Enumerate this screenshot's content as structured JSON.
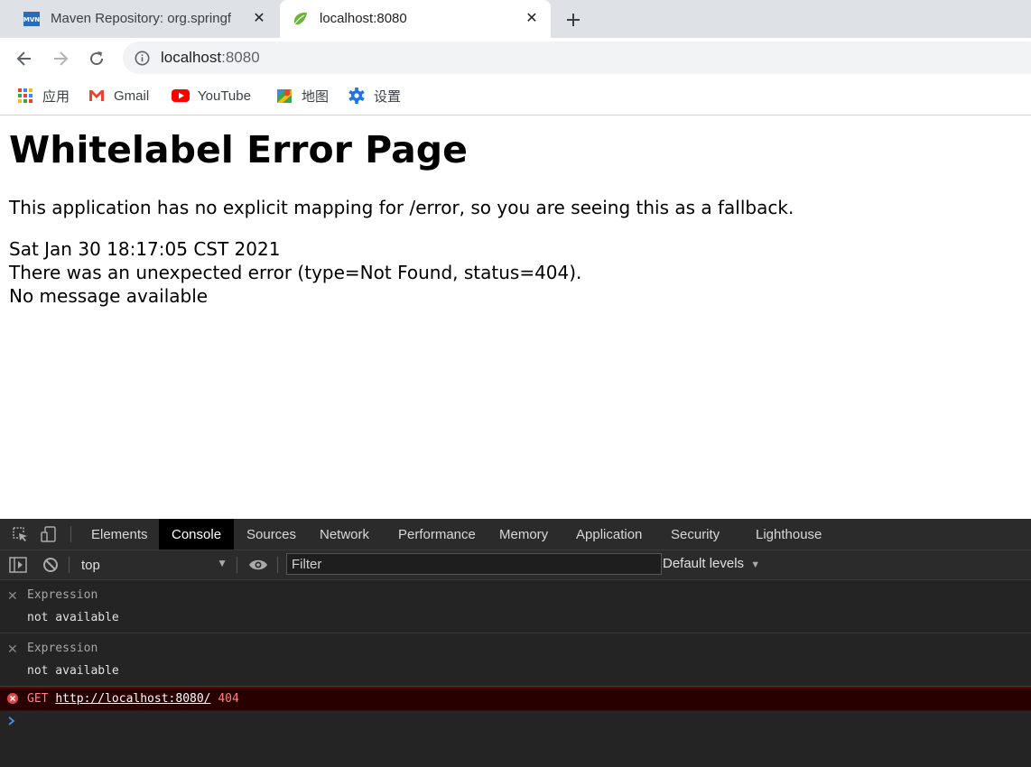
{
  "browser": {
    "tabs": [
      {
        "title": "Maven Repository: org.springf",
        "favicon": "mvn-icon",
        "favicon_text": "MVN",
        "active": false
      },
      {
        "title": "localhost:8080",
        "favicon": "spring-leaf-icon",
        "active": true
      }
    ],
    "address": {
      "host": "localhost",
      "port": ":8080"
    },
    "bookmarks": [
      {
        "label": "应用",
        "icon": "apps-grid-icon"
      },
      {
        "label": "Gmail",
        "icon": "gmail-icon"
      },
      {
        "label": "YouTube",
        "icon": "youtube-icon"
      },
      {
        "label": "地图",
        "icon": "maps-icon"
      },
      {
        "label": "设置",
        "icon": "gear-icon"
      }
    ]
  },
  "page": {
    "heading": "Whitelabel Error Page",
    "explanation": "This application has no explicit mapping for /error, so you are seeing this as a fallback.",
    "timestamp": "Sat Jan 30 18:17:05 CST 2021",
    "error_line": "There was an unexpected error (type=Not Found, status=404).",
    "message": "No message available"
  },
  "devtools": {
    "tabs": [
      "Elements",
      "Console",
      "Sources",
      "Network",
      "Performance",
      "Memory",
      "Application",
      "Security",
      "Lighthouse"
    ],
    "active_tab": "Console",
    "context": "top",
    "filter_placeholder": "Filter",
    "levels": "Default levels",
    "expressions": [
      {
        "label": "Expression",
        "value": "not available"
      },
      {
        "label": "Expression",
        "value": "not available"
      }
    ],
    "error": {
      "method": "GET",
      "url": "http://localhost:8080/",
      "status": "404"
    },
    "colors": {
      "error_bg": "#290000",
      "error_text": "#ff8080",
      "active_tab_bg": "#000000",
      "prompt": "#4a90e2"
    }
  }
}
